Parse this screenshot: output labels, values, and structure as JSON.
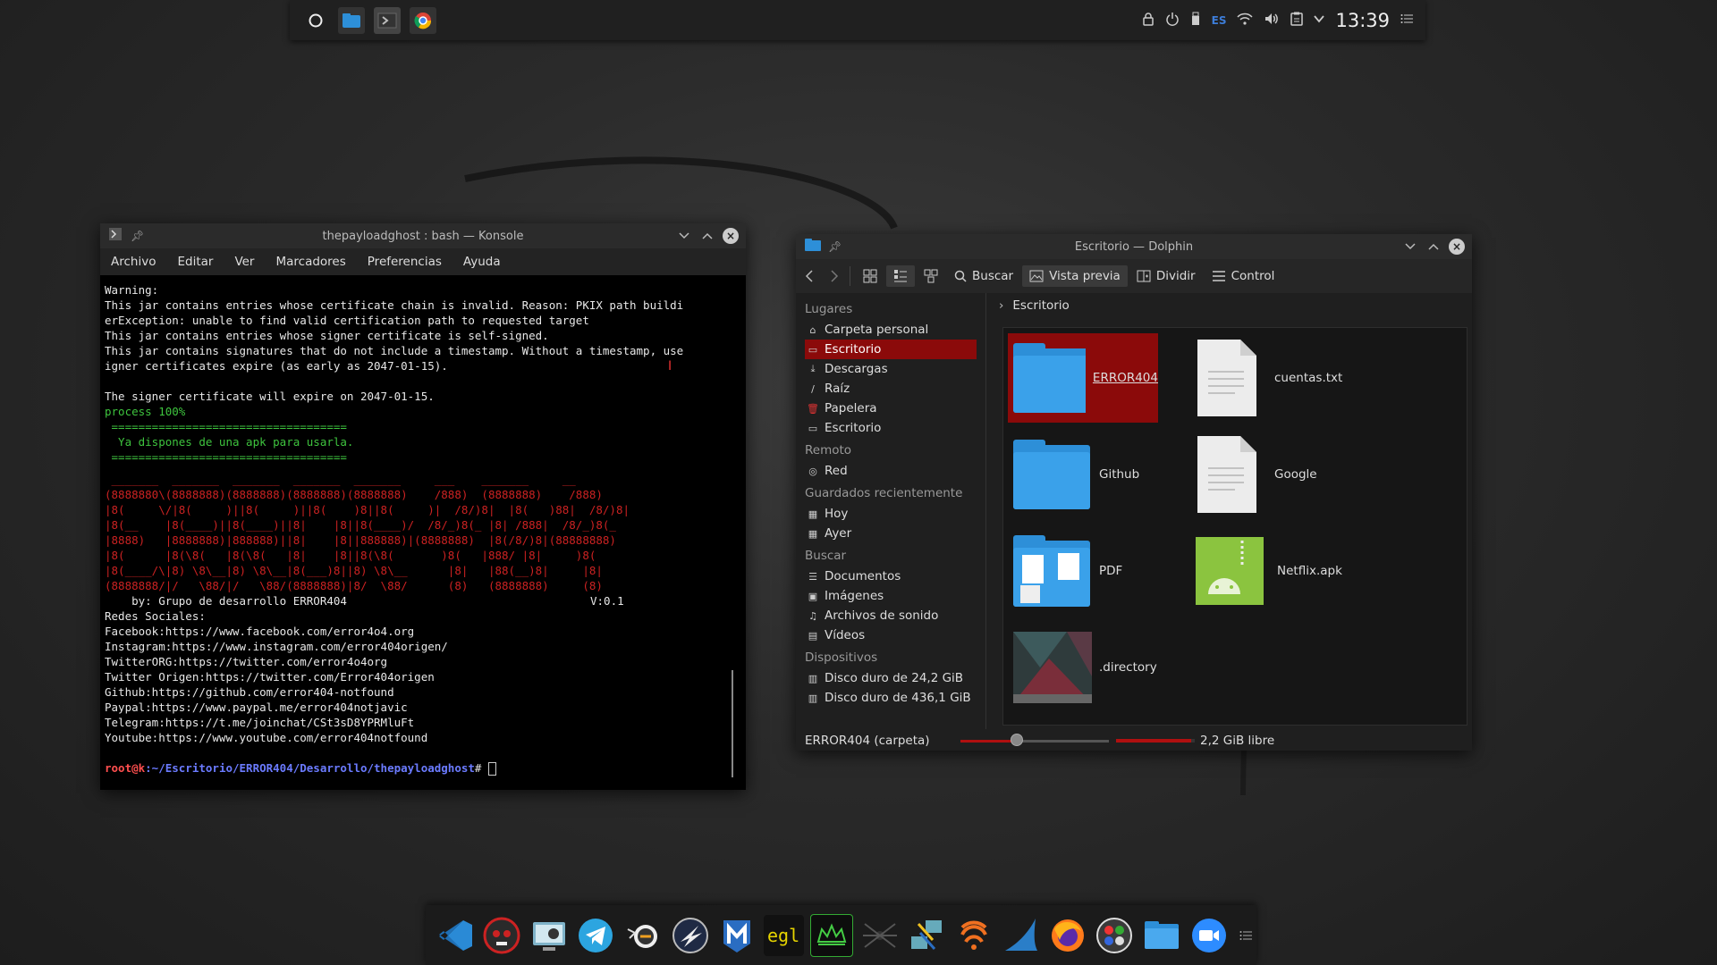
{
  "top_panel": {
    "apps": [
      "app-launcher-icon",
      "file-manager-icon",
      "terminal-icon",
      "chrome-icon"
    ],
    "tray": {
      "lock": "lock-icon",
      "power": "power-icon",
      "usb": "usb-icon",
      "keyboard_layout": "ES",
      "wifi": "wifi-icon",
      "volume": "volume-icon",
      "clipboard": "clipboard-icon",
      "expand": "chevron-down-icon",
      "clock": "13:39",
      "menu": "menu-icon"
    }
  },
  "konsole": {
    "title": "thepayloadghost : bash — Konsole",
    "menu": [
      "Archivo",
      "Editar",
      "Ver",
      "Marcadores",
      "Preferencias",
      "Ayuda"
    ],
    "output_white_1": "Warning:\nThis jar contains entries whose certificate chain is invalid. Reason: PKIX path buildi\nerException: unable to find valid certification path to requested target\nThis jar contains entries whose signer certificate is self-signed.\nThis jar contains signatures that do not include a timestamp. Without a timestamp, use\nigner certificates expire (as early as 2047-01-15).\n\nThe signer certificate will expire on 2047-01-15.",
    "output_green": "process 100%\n ===================================\n  Ya dispones de una apk para usarla.\n ===================================",
    "ascii_banner": " _______  _______  _______  _______  _______     ___    _______     __\n(8888880\\(8888888)(8888888)(8888888)(8888888)    /888)  (8888888)    /888)\n|8(     \\/|8(     )||8(     )||8(    )8||8(     )|  /8/)8|  |8(   )88|  /8/)8|\n|8(__    |8(____)||8(____)||8|    |8||8(____)/  /8/_)8(_ |8| /888|  /8/_)8(_\n|8888)   |8888888)|888888)||8|    |8||888888)|(8888888)  |8(/8/)8|(88888888)\n|8(      |8(\\8(   |8(\\8(   |8|    |8||8(\\8(       )8(   |888/ |8|     )8(\n|8(____/\\|8) \\8\\__|8) \\8\\__|8(___)8||8) \\8\\__      |8|   |88(__)8|     |8|\n(8888888/|/   \\88/|/   \\88/(8888888)|8/  \\88/      (8)   (8888888)     (8)",
    "credit": "    by: Grupo de desarrollo ERROR404",
    "version": "V:0.1",
    "output_white_2": "Redes Sociales:\nFacebook:https://www.facebook.com/error4o4.org\nInstagram:https://www.instagram.com/error404origen/\nTwitterORG:https://twitter.com/error4o4org\nTwitter Origen:https://twitter.com/Error404origen\nGithub:https://github.com/error404-notfound\nPaypal:https://www.paypal.me/error404notjavic\nTelegram:https://t.me/joinchat/CSt3sD8YPRMluFt\nYoutube:https://www.youtube.com/error404notfound",
    "prompt_user": "root@k",
    "prompt_path": ":~/Escritorio/ERROR404/Desarrollo/thepayloadghost",
    "prompt_symbol": "# "
  },
  "dolphin": {
    "title": "Escritorio — Dolphin",
    "toolbar": {
      "search": "Buscar",
      "preview": "Vista previa",
      "split": "Dividir",
      "control": "Control"
    },
    "sidebar": {
      "places_header": "Lugares",
      "places": [
        "Carpeta personal",
        "Escritorio",
        "Descargas",
        "Raíz",
        "Papelera",
        "Escritorio"
      ],
      "remote_header": "Remoto",
      "remote": [
        "Red"
      ],
      "recent_header": "Guardados recientemente",
      "recent": [
        "Hoy",
        "Ayer"
      ],
      "search_header": "Buscar",
      "search": [
        "Documentos",
        "Imágenes",
        "Archivos de sonido",
        "Vídeos"
      ],
      "devices_header": "Dispositivos",
      "devices": [
        "Disco duro de 24,2 GiB",
        "Disco duro de 436,1 GiB"
      ]
    },
    "breadcrumb": "Escritorio",
    "files": {
      "error404": "ERROR404",
      "cuentas": "cuentas.txt",
      "github": "Github",
      "google": "Google",
      "pdf": "PDF",
      "netflix": "Netflix.apk",
      "directory": ".directory"
    },
    "status": {
      "selection": "ERROR404 (carpeta)",
      "zoom_fraction": 0.37,
      "free_space": "2,2 GiB libre",
      "used_fraction": 0.95
    }
  },
  "dock": {
    "apps": [
      "vscode-icon",
      "metasploit-skull-icon",
      "screenshot-icon",
      "telegram-icon",
      "bird-tool-icon",
      "zenmap-icon",
      "maltego-icon",
      "terminal-ascii-icon",
      "green-crown-icon",
      "spider-icon",
      "network-transfer-icon",
      "burpsuite-icon",
      "wireshark-fin-icon",
      "firefox-icon",
      "color-picker-icon",
      "file-manager-icon",
      "zoom-icon",
      "dock-menu-icon"
    ]
  },
  "colors": {
    "accent_red": "#8b0a0a",
    "terminal_green": "#3ec43e",
    "terminal_red": "#cc2222",
    "prompt_blue": "#6b7bff"
  }
}
